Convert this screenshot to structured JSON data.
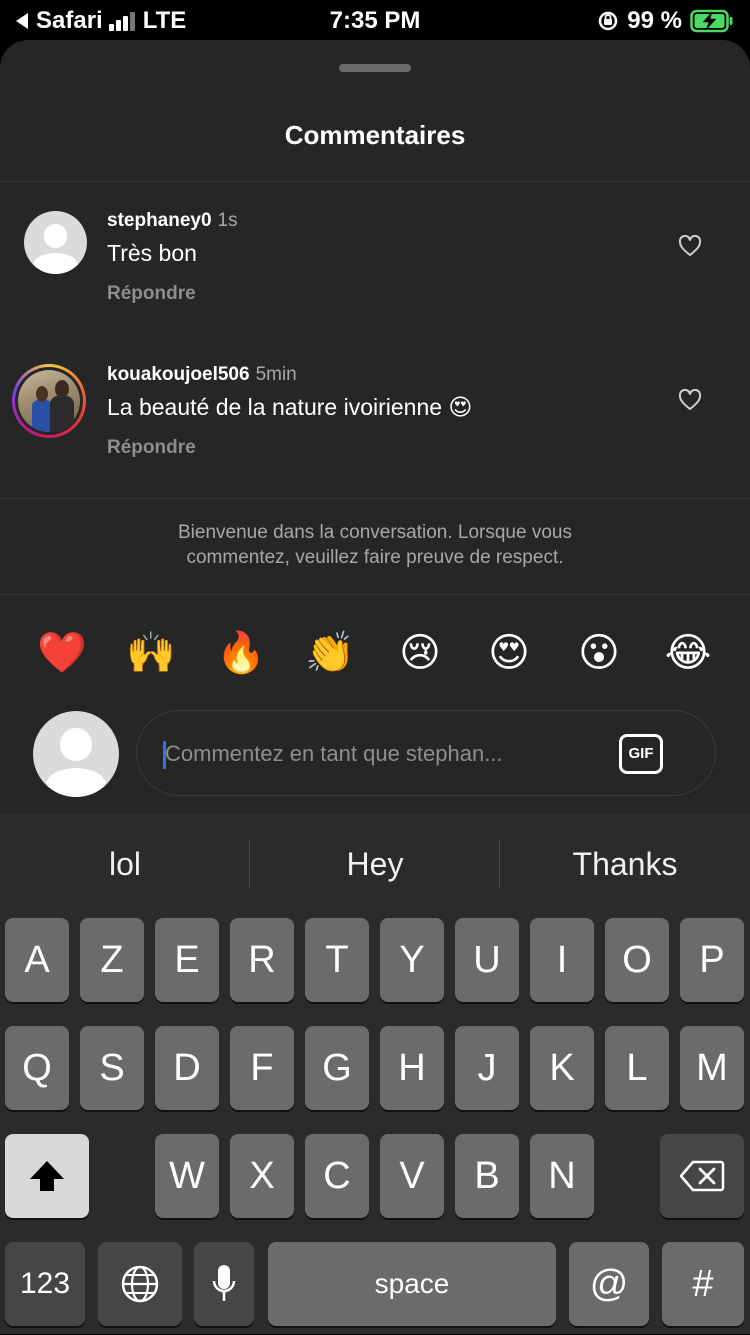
{
  "status_bar": {
    "back_app": "Safari",
    "network": "LTE",
    "time": "7:35 PM",
    "battery": "99 %"
  },
  "sheet": {
    "title": "Commentaires"
  },
  "comments": [
    {
      "username": "stephaney0",
      "time": "1s",
      "text": "Très bon",
      "reply_label": "Répondre",
      "avatar": "default-avatar"
    },
    {
      "username": "kouakoujoel506",
      "time": "5min",
      "text": "La beauté de la nature ivoirienne 😍",
      "reply_label": "Répondre",
      "avatar": "photo-avatar-with-story-ring"
    }
  ],
  "welcome_message": {
    "line1": "Bienvenue dans la conversation. Lorsque vous",
    "line2": "commentez, veuillez faire preuve de respect."
  },
  "quick_emojis": [
    "❤️",
    "🙌",
    "🔥",
    "👏",
    "😢",
    "😍",
    "😮",
    "😂"
  ],
  "comment_input": {
    "placeholder": "Commentez en tant que stephan...",
    "gif_label": "GIF"
  },
  "keyboard": {
    "predictions": [
      "lol",
      "Hey",
      "Thanks"
    ],
    "row1": [
      "A",
      "Z",
      "E",
      "R",
      "T",
      "Y",
      "U",
      "I",
      "O",
      "P"
    ],
    "row2": [
      "Q",
      "S",
      "D",
      "F",
      "G",
      "H",
      "J",
      "K",
      "L",
      "M"
    ],
    "row3": [
      "W",
      "X",
      "C",
      "V",
      "B",
      "N"
    ],
    "numbers_key": "123",
    "space_key": "space",
    "at_key": "@",
    "hash_key": "#"
  },
  "colors": {
    "sheet_bg": "#262626",
    "keyboard_bg": "#2b2b2b",
    "caret": "#3e6ee6",
    "battery_charging": "#4cd964"
  }
}
